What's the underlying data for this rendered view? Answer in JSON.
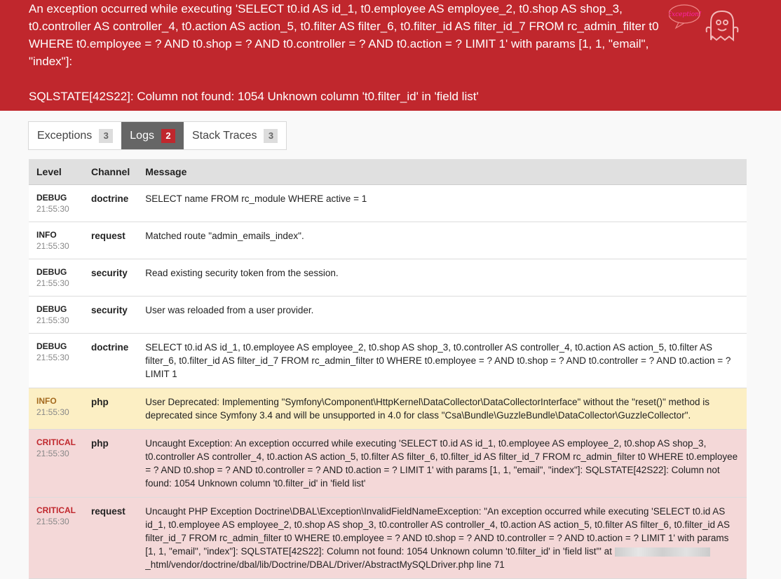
{
  "header": {
    "query_text": "An exception occurred while executing 'SELECT t0.id AS id_1, t0.employee AS employee_2, t0.shop AS shop_3, t0.controller AS controller_4, t0.action AS action_5, t0.filter AS filter_6, t0.filter_id AS filter_id_7 FROM rc_admin_filter t0 WHERE t0.employee = ? AND t0.shop = ? AND t0.controller = ? AND t0.action = ? LIMIT 1' with params [1, 1, \"email\", \"index\"]:",
    "sqlstate_text": "SQLSTATE[42S22]: Column not found: 1054 Unknown column 't0.filter_id' in 'field list'",
    "ghost_label": "Exception!",
    "bg_color": "#c0272d"
  },
  "tabs": [
    {
      "label": "Exceptions",
      "count": "3"
    },
    {
      "label": "Logs",
      "count": "2"
    },
    {
      "label": "Stack Traces",
      "count": "3"
    }
  ],
  "table": {
    "headers": {
      "level": "Level",
      "channel": "Channel",
      "message": "Message"
    },
    "rows": [
      {
        "level": "DEBUG",
        "time": "21:55:30",
        "channel": "doctrine",
        "message": "SELECT name FROM rc_module WHERE active = 1"
      },
      {
        "level": "INFO",
        "time": "21:55:30",
        "channel": "request",
        "message": "Matched route \"admin_emails_index\"."
      },
      {
        "level": "DEBUG",
        "time": "21:55:30",
        "channel": "security",
        "message": "Read existing security token from the session."
      },
      {
        "level": "DEBUG",
        "time": "21:55:30",
        "channel": "security",
        "message": "User was reloaded from a user provider."
      },
      {
        "level": "DEBUG",
        "time": "21:55:30",
        "channel": "doctrine",
        "message": "SELECT t0.id AS id_1, t0.employee AS employee_2, t0.shop AS shop_3, t0.controller AS controller_4, t0.action AS action_5, t0.filter AS filter_6, t0.filter_id AS filter_id_7 FROM rc_admin_filter t0 WHERE t0.employee = ? AND t0.shop = ? AND t0.controller = ? AND t0.action = ? LIMIT 1"
      },
      {
        "level": "INFO",
        "time": "21:55:30",
        "channel": "php",
        "message": "User Deprecated: Implementing \"Symfony\\Component\\HttpKernel\\DataCollector\\DataCollectorInterface\" without the \"reset()\" method is deprecated since Symfony 3.4 and will be unsupported in 4.0 for class \"Csa\\Bundle\\GuzzleBundle\\DataCollector\\GuzzleCollector\"."
      },
      {
        "level": "CRITICAL",
        "time": "21:55:30",
        "channel": "php",
        "message": "Uncaught Exception: An exception occurred while executing 'SELECT t0.id AS id_1, t0.employee AS employee_2, t0.shop AS shop_3, t0.controller AS controller_4, t0.action AS action_5, t0.filter AS filter_6, t0.filter_id AS filter_id_7 FROM rc_admin_filter t0 WHERE t0.employee = ? AND t0.shop = ? AND t0.controller = ? AND t0.action = ? LIMIT 1' with params [1, 1, \"email\", \"index\"]: SQLSTATE[42S22]: Column not found: 1054 Unknown column 't0.filter_id' in 'field list'"
      },
      {
        "level": "CRITICAL",
        "time": "21:55:30",
        "channel": "request",
        "message": "Uncaught PHP Exception Doctrine\\DBAL\\Exception\\InvalidFieldNameException: \"An exception occurred while executing 'SELECT t0.id AS id_1, t0.employee AS employee_2, t0.shop AS shop_3, t0.controller AS controller_4, t0.action AS action_5, t0.filter AS filter_6, t0.filter_id AS filter_id_7 FROM rc_admin_filter t0 WHERE t0.employee = ? AND t0.shop = ? AND t0.controller = ? AND t0.action = ? LIMIT 1' with params [1, 1, \"email\", \"index\"]: SQLSTATE[42S22]: Column not found: 1054 Unknown column 't0.filter_id' in 'field list'\" at",
        "message_tail": "_html/vendor/doctrine/dbal/lib/Doctrine/DBAL/Driver/AbstractMySQLDriver.php line 71"
      }
    ]
  }
}
